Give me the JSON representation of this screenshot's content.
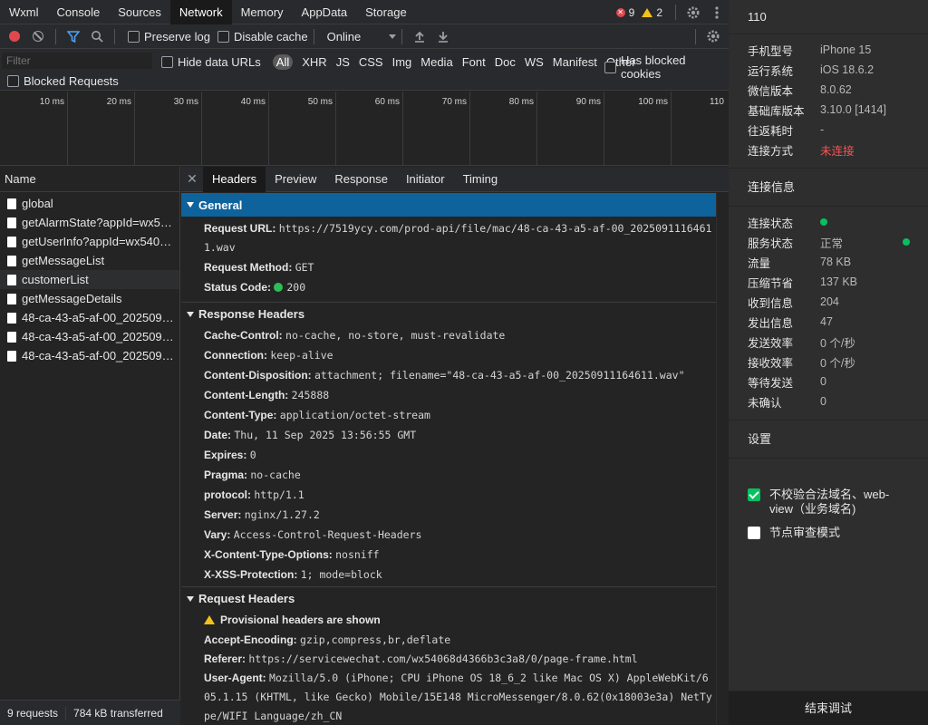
{
  "topbar": {
    "tabs": [
      "Wxml",
      "Console",
      "Sources",
      "Network",
      "Memory",
      "AppData",
      "Storage"
    ],
    "active_tab": "Network",
    "errors": "9",
    "warnings": "2"
  },
  "toolbar": {
    "preserve_log": "Preserve log",
    "disable_cache": "Disable cache",
    "throttle": "Online"
  },
  "filter": {
    "placeholder": "Filter",
    "hide_data_urls": "Hide data URLs",
    "types": [
      "All",
      "XHR",
      "JS",
      "CSS",
      "Img",
      "Media",
      "Font",
      "Doc",
      "WS",
      "Manifest",
      "Other"
    ],
    "has_blocked_cookies": "Has blocked cookies",
    "blocked_requests": "Blocked Requests"
  },
  "timeline": {
    "ticks": [
      "10 ms",
      "20 ms",
      "30 ms",
      "40 ms",
      "50 ms",
      "60 ms",
      "70 ms",
      "80 ms",
      "90 ms",
      "100 ms",
      "110"
    ]
  },
  "requests": {
    "header": "Name",
    "items": [
      "global",
      "getAlarmState?appId=wx5406...",
      "getUserInfo?appId=wx54068d...",
      "getMessageList",
      "customerList",
      "getMessageDetails",
      "48-ca-43-a5-af-00_2025091...",
      "48-ca-43-a5-af-00_2025091...",
      "48-ca-43-a5-af-00_2025091..."
    ],
    "selected_index": 4,
    "count": "9 requests",
    "transferred": "784 kB transferred"
  },
  "detail": {
    "tabs": [
      "Headers",
      "Preview",
      "Response",
      "Initiator",
      "Timing"
    ],
    "active_tab": "Headers",
    "general": {
      "title": "General",
      "request_url_key": "Request URL:",
      "request_url": "https://7519ycy.com/prod-api/file/mac/48-ca-43-a5-af-00_20250911164611.wav",
      "method_key": "Request Method:",
      "method": "GET",
      "status_key": "Status Code:",
      "status": "200"
    },
    "response_headers": {
      "title": "Response Headers",
      "items": [
        {
          "k": "Cache-Control:",
          "v": "no-cache, no-store, must-revalidate"
        },
        {
          "k": "Connection:",
          "v": "keep-alive"
        },
        {
          "k": "Content-Disposition:",
          "v": "attachment; filename=\"48-ca-43-a5-af-00_20250911164611.wav\""
        },
        {
          "k": "Content-Length:",
          "v": "245888"
        },
        {
          "k": "Content-Type:",
          "v": "application/octet-stream"
        },
        {
          "k": "Date:",
          "v": "Thu, 11 Sep 2025 13:56:55 GMT"
        },
        {
          "k": "Expires:",
          "v": "0"
        },
        {
          "k": "Pragma:",
          "v": "no-cache"
        },
        {
          "k": "protocol:",
          "v": "http/1.1"
        },
        {
          "k": "Server:",
          "v": "nginx/1.27.2"
        },
        {
          "k": "Vary:",
          "v": "Access-Control-Request-Headers"
        },
        {
          "k": "X-Content-Type-Options:",
          "v": "nosniff"
        },
        {
          "k": "X-XSS-Protection:",
          "v": "1; mode=block"
        }
      ]
    },
    "request_headers": {
      "title": "Request Headers",
      "provisional": "Provisional headers are shown",
      "items": [
        {
          "k": "Accept-Encoding:",
          "v": "gzip,compress,br,deflate"
        },
        {
          "k": "Referer:",
          "v": "https://servicewechat.com/wx54068d4366b3c3a8/0/page-frame.html"
        },
        {
          "k": "User-Agent:",
          "v": "Mozilla/5.0 (iPhone; CPU iPhone OS 18_6_2 like Mac OS X) AppleWebKit/605.1.15 (KHTML, like Gecko) Mobile/15E148 MicroMessenger/8.0.62(0x18003e3a) NetType/WIFI Language/zh_CN"
        }
      ]
    }
  },
  "right_panel": {
    "title": "110",
    "device": [
      {
        "k": "手机型号",
        "v": "iPhone 15"
      },
      {
        "k": "运行系统",
        "v": "iOS 18.6.2"
      },
      {
        "k": "微信版本",
        "v": "8.0.62"
      },
      {
        "k": "基础库版本",
        "v": "3.10.0 [1414]"
      },
      {
        "k": "往返耗时",
        "v": "-"
      },
      {
        "k": "连接方式",
        "v": "未连接"
      }
    ],
    "connection_title": "连接信息",
    "connection": [
      {
        "k": "连接状态",
        "v": ""
      },
      {
        "k": "服务状态",
        "v": "正常"
      },
      {
        "k": "流量",
        "v": "78 KB"
      },
      {
        "k": "压缩节省",
        "v": "137 KB"
      },
      {
        "k": "收到信息",
        "v": "204"
      },
      {
        "k": "发出信息",
        "v": "47"
      },
      {
        "k": "发送效率",
        "v": "0 个/秒"
      },
      {
        "k": "接收效率",
        "v": "0 个/秒"
      },
      {
        "k": "等待发送",
        "v": "0"
      },
      {
        "k": "未确认",
        "v": "0"
      }
    ],
    "settings_title": "设置",
    "option_domain": "不校验合法域名、web-view（业务域名)",
    "option_audit": "节点审查模式",
    "end_debug": "结束调试",
    "colors": {
      "online": "#07c160",
      "disconnected": "#fa5151"
    }
  }
}
